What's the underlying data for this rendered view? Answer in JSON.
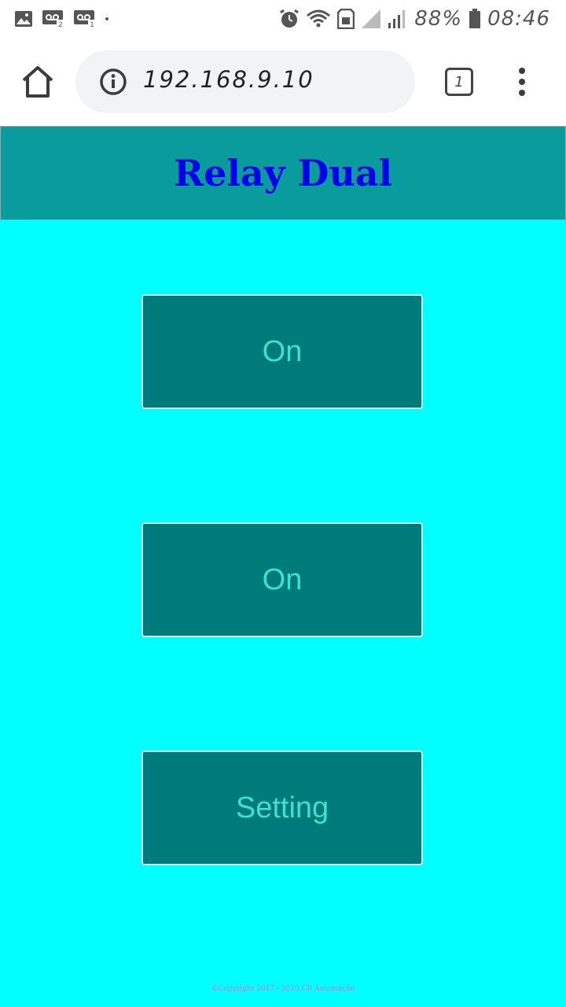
{
  "status_bar": {
    "battery": "88%",
    "time": "08:46",
    "icons": [
      "image-icon",
      "voicemail-2-icon",
      "voicemail-1-icon",
      "alarm-icon",
      "wifi-icon",
      "sim-icon",
      "signal-weak-icon",
      "signal-icon",
      "battery-icon"
    ]
  },
  "browser": {
    "url": "192.168.9.10",
    "tab_count": "1",
    "icons": [
      "home-icon",
      "info-icon",
      "tab-switcher-icon",
      "menu-icon"
    ]
  },
  "page": {
    "title": "Relay Dual",
    "buttons": [
      {
        "label": "On"
      },
      {
        "label": "On"
      },
      {
        "label": "Setting"
      }
    ],
    "footer": "©Copyright 2017 - 2020 CR Automação"
  },
  "colors": {
    "page_background": "#00ffff",
    "header_background": "#0a9c9c",
    "title_text": "#0000ee",
    "button_background": "#007b7b",
    "button_text": "#40e0d0"
  }
}
